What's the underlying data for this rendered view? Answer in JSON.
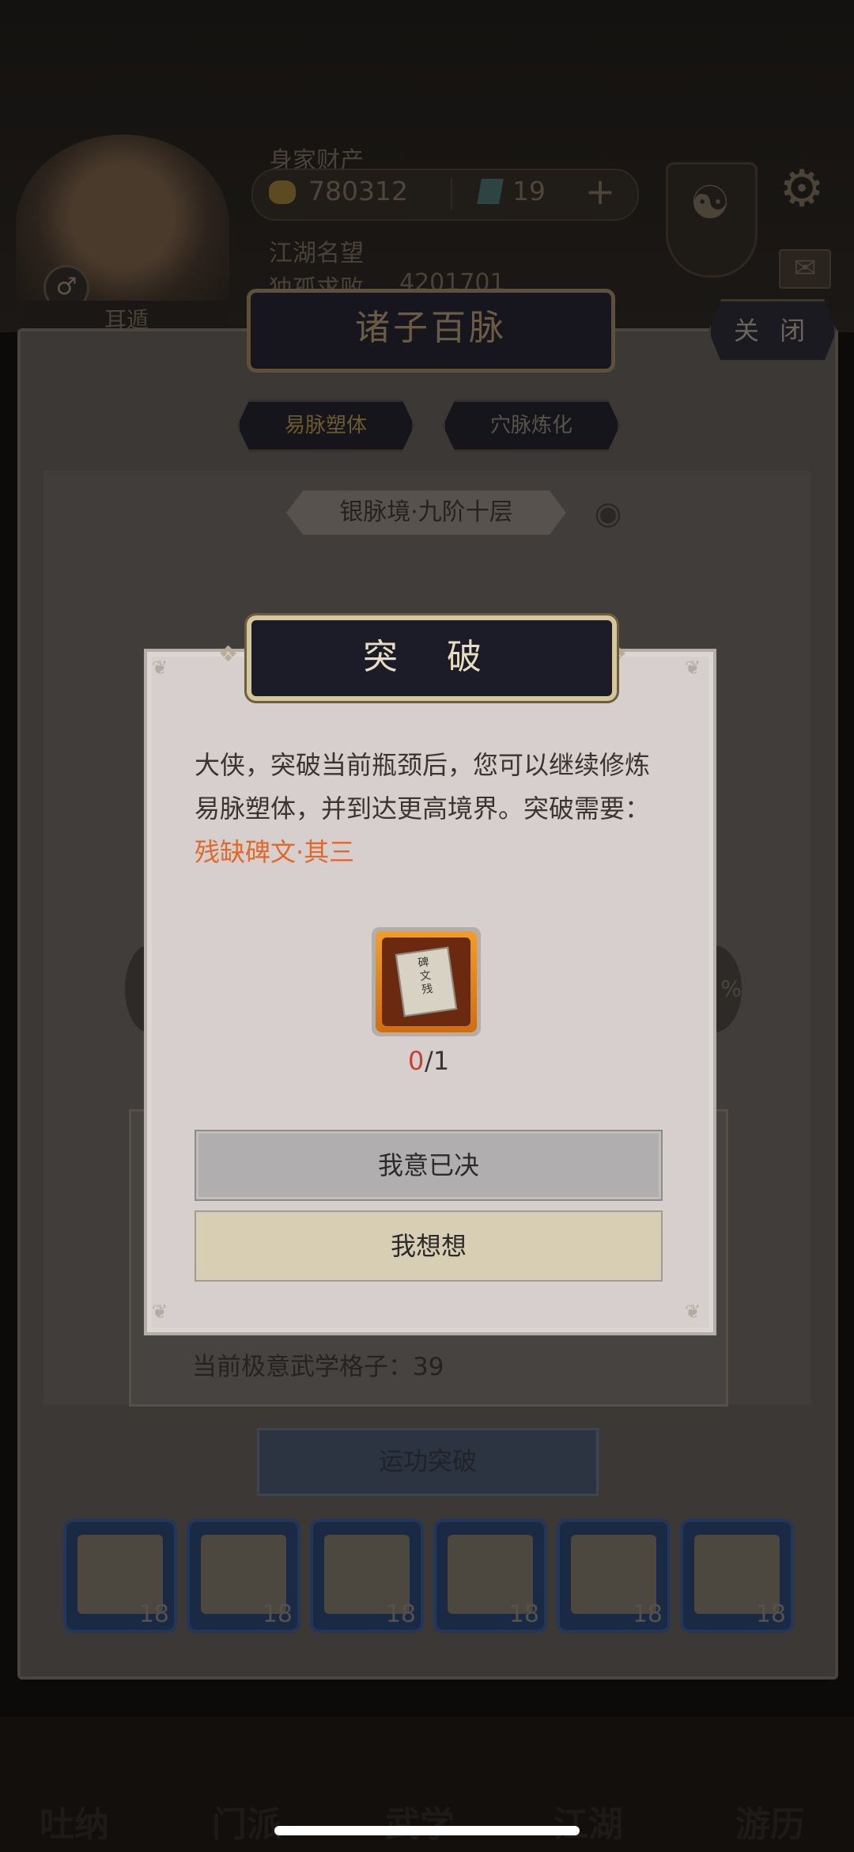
{
  "hud": {
    "assets_label": "身家财产",
    "coins": "780312",
    "gems": "19",
    "reputation_label": "江湖名望",
    "title_line": "独孤求败",
    "title_value": "4201701",
    "left_tab": "耳遁"
  },
  "panel": {
    "title": "诸子百脉",
    "close": "关 闭",
    "tabs": [
      "易脉塑体",
      "穴脉炼化"
    ],
    "realm": "银脉境·九阶十层",
    "side_pct": "%",
    "grid_count": "当前极意武学格子：39",
    "break_button": "运功突破",
    "scroll_counts": [
      "18",
      "18",
      "18",
      "18",
      "18",
      "18"
    ]
  },
  "dialog": {
    "title": "突 破",
    "message": "大侠，突破当前瓶颈后，您可以继续修炼易脉塑体，并到达更高境界。突破需要：",
    "requirement": "残缺碑文·其三",
    "item_have": "0",
    "item_need": "/1",
    "confirm": "我意已决",
    "think": "我想想"
  },
  "nav": [
    "吐纳",
    "门派",
    "武学",
    "江湖",
    "游历"
  ],
  "colors": {
    "accent_orange": "#e0692c",
    "have_red": "#c9402f",
    "title_gold": "#e8dcc1"
  }
}
